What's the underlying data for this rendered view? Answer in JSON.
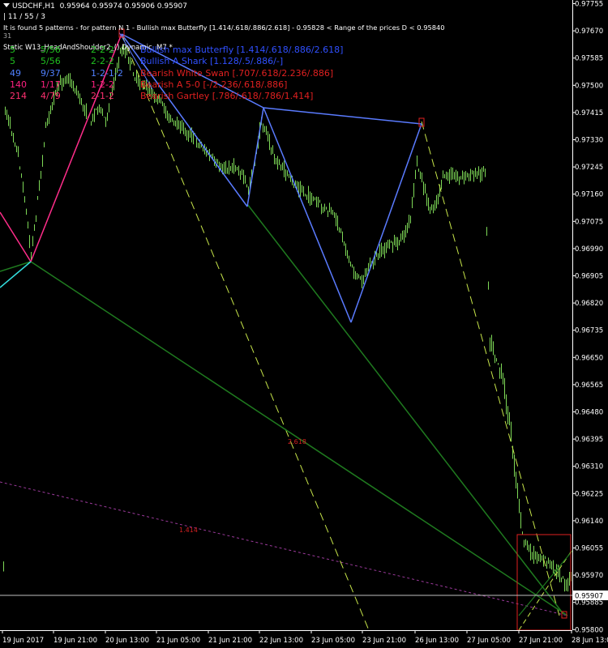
{
  "header": {
    "symbol": "USDCHF,H1",
    "ohlc": "0.95964 0.95974 0.95906 0.95907",
    "counts": "| 11 / 55 / 3",
    "found_text": "It is found 5 patterns  -  for pattern N 1 - Bullish max Butterfly [1.414/.618/.886/2.618] - 0.95828 < Range of the prices D < 0.95840",
    "static_text": "Static   W13_HeadAndShoulder2_()  Dynamic, M7   *"
  },
  "pattern_table": [
    {
      "num": "5",
      "ratio": "5/56",
      "code": "2-2-2",
      "name": "Bullish max Butterfly [1.414/.618/.886/2.618]",
      "color": "#3050ff",
      "num_color": "#20c020"
    },
    {
      "num": "5",
      "ratio": "5/56",
      "code": "2-2-2",
      "name": "Bullish A Shark [1.128/.5/.886/-]",
      "color": "#3050ff",
      "num_color": "#20c020"
    },
    {
      "num": "49",
      "ratio": "9/37",
      "code": "1-2-1-2",
      "name": "Bearish White Swan [.707/.618/2.236/.886]",
      "color": "#e02020",
      "num_color": "#5080ff"
    },
    {
      "num": "140",
      "ratio": "1/17",
      "code": "1-2-2",
      "name": "Bearish A 5-0 [-/2.236/.618/.886]",
      "color": "#e02020",
      "num_color": "#ff2080"
    },
    {
      "num": "214",
      "ratio": "4/79",
      "code": "2-1-2",
      "name": "Bearish Gartley [.786/.618/.786/1.414]",
      "color": "#e02020",
      "num_color": "#ff3070"
    }
  ],
  "annotations": {
    "fib_2618": "2.618",
    "fib_1414": "1.414",
    "corner_mark": "31"
  },
  "price_axis": {
    "labels": [
      "0.97755",
      "0.97670",
      "0.97585",
      "0.97500",
      "0.97415",
      "0.97330",
      "0.97245",
      "0.97160",
      "0.97075",
      "0.96990",
      "0.96905",
      "0.96820",
      "0.96735",
      "0.96650",
      "0.96565",
      "0.96480",
      "0.96395",
      "0.96310",
      "0.96225",
      "0.96140",
      "0.96055",
      "0.95970",
      "0.95885",
      "0.95800"
    ],
    "current_price": "0.95907"
  },
  "time_axis": {
    "labels": [
      "19 Jun 2017",
      "19 Jun 21:00",
      "20 Jun 13:00",
      "21 Jun 05:00",
      "21 Jun 21:00",
      "22 Jun 13:00",
      "23 Jun 05:00",
      "23 Jun 21:00",
      "26 Jun 13:00",
      "27 Jun 05:00",
      "27 Jun 21:00",
      "28 Jun 13:00"
    ]
  },
  "colors": {
    "background": "#000000",
    "candles": "#7ed957",
    "axis_text": "#ffffff",
    "pattern_blue": "#5a7bff",
    "pattern_pink": "#ff2d8a",
    "pattern_cyan": "#33dddd",
    "trend_green": "#1f7a1f",
    "dashed_yellow": "#c8e64a",
    "dotted_purple": "#9b3a9b",
    "box_red": "#e02020",
    "fib_text": "#d02020"
  },
  "chart_data": {
    "type": "line",
    "title": "USDCHF,H1",
    "symbol": "USDCHF",
    "timeframe": "H1",
    "ohlc_last": {
      "open": 0.95964,
      "high": 0.95974,
      "low": 0.95906,
      "close": 0.95907
    },
    "ylim": [
      0.958,
      0.978
    ],
    "x": [
      "19 Jun 2017",
      "19 Jun 21:00",
      "20 Jun 13:00",
      "21 Jun 05:00",
      "21 Jun 21:00",
      "22 Jun 13:00",
      "23 Jun 05:00",
      "23 Jun 21:00",
      "26 Jun 13:00",
      "27 Jun 05:00",
      "27 Jun 21:00",
      "28 Jun 13:00"
    ],
    "series": [
      {
        "name": "Close",
        "values": [
          0.974,
          0.9725,
          0.9758,
          0.9738,
          0.9724,
          0.9705,
          0.9688,
          0.9692,
          0.972,
          0.9672,
          0.9595,
          0.96
        ]
      }
    ],
    "pivots": {
      "bearish_left": [
        [
          0,
          0.9696
        ],
        [
          2.3,
          0.9769
        ]
      ],
      "bullish_upper": [
        [
          2.3,
          0.9769
        ],
        [
          4.8,
          0.9715
        ],
        [
          5.2,
          0.97425
        ],
        [
          7.2,
          0.9676
        ],
        [
          9.0,
          0.97385
        ],
        [
          5.2,
          0.97425
        ],
        [
          2.3,
          0.9769
        ]
      ]
    },
    "current_price": 0.95907,
    "grid": false
  }
}
